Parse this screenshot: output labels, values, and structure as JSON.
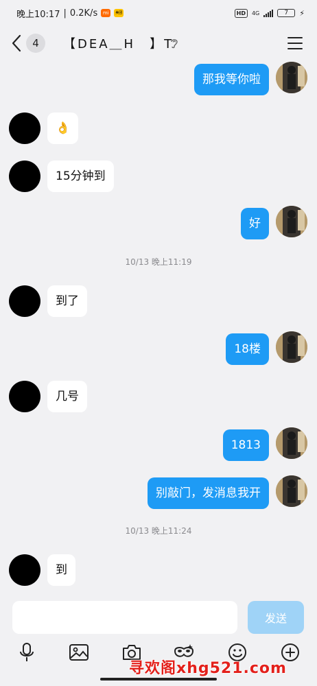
{
  "status_bar": {
    "time": "晚上10:17",
    "net_speed": "0.2K/s",
    "app_icon_1": "mi",
    "app_icon_2": "美团",
    "hd": "HD",
    "network": "4G",
    "battery": "7",
    "icons": [
      "mi-app-icon",
      "meituan-app-icon",
      "hd-icon",
      "signal-icon",
      "battery-icon",
      "charging-icon"
    ]
  },
  "header": {
    "unread_count": "4",
    "title": "【DEA＿H　】T",
    "icons": [
      "back-arrow-icon",
      "ear-icon",
      "menu-icon"
    ]
  },
  "messages": [
    {
      "side": "out",
      "text": "那我等你啦"
    },
    {
      "side": "in",
      "text": "👌"
    },
    {
      "side": "in",
      "text": "15分钟到"
    },
    {
      "side": "out",
      "text": "好"
    },
    {
      "side": "time",
      "text": "10/13 晚上11:19"
    },
    {
      "side": "in",
      "text": "到了"
    },
    {
      "side": "out",
      "text": "18楼"
    },
    {
      "side": "in",
      "text": "几号"
    },
    {
      "side": "out",
      "text": "1813"
    },
    {
      "side": "out",
      "text": "别敲门，发消息我开"
    },
    {
      "side": "time",
      "text": "10/13 晚上11:24"
    },
    {
      "side": "in",
      "text": "到"
    }
  ],
  "input": {
    "value": "",
    "send_label": "发送"
  },
  "toolbar": {
    "icons": [
      "microphone-icon",
      "image-icon",
      "camera-icon",
      "mask-icon",
      "emoji-icon",
      "plus-icon"
    ]
  },
  "watermark": "寻欢阁xhg521.com",
  "colors": {
    "outgoing_bubble": "#1e9bf5",
    "incoming_bubble": "#ffffff",
    "background": "#f1f1f3",
    "send_button": "#9fd3f7",
    "watermark": "#e3201b"
  }
}
